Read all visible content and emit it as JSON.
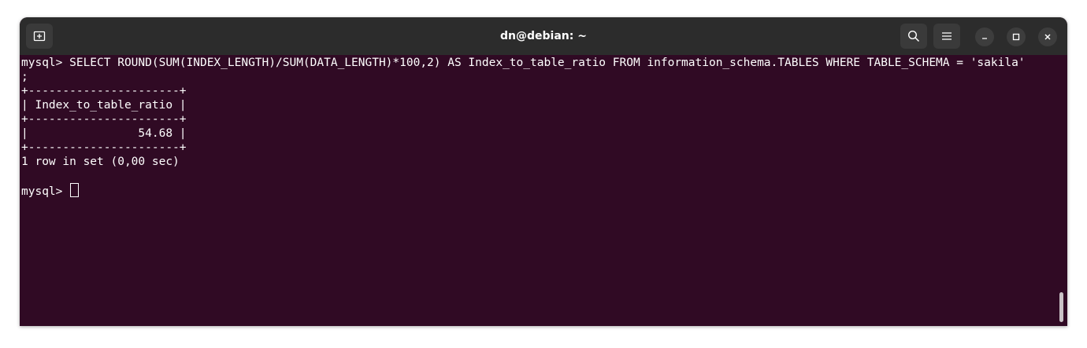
{
  "window": {
    "title": "dn@debian: ~"
  },
  "titlebar": {
    "icons": [
      "new-tab-icon",
      "search-icon",
      "hamburger-menu-icon",
      "minimize-icon",
      "maximize-icon",
      "close-icon"
    ]
  },
  "terminal": {
    "lines": [
      "mysql> SELECT ROUND(SUM(INDEX_LENGTH)/SUM(DATA_LENGTH)*100,2) AS Index_to_table_ratio FROM information_schema.TABLES WHERE TABLE_SCHEMA = 'sakila'",
      ";",
      "+----------------------+",
      "| Index_to_table_ratio |",
      "+----------------------+",
      "|                54.68 |",
      "+----------------------+",
      "1 row in set (0,00 sec)",
      "",
      "mysql> "
    ]
  },
  "colors": {
    "terminal_bg": "#300a24",
    "titlebar_bg": "#2c2c2c",
    "text": "#ffffff"
  }
}
